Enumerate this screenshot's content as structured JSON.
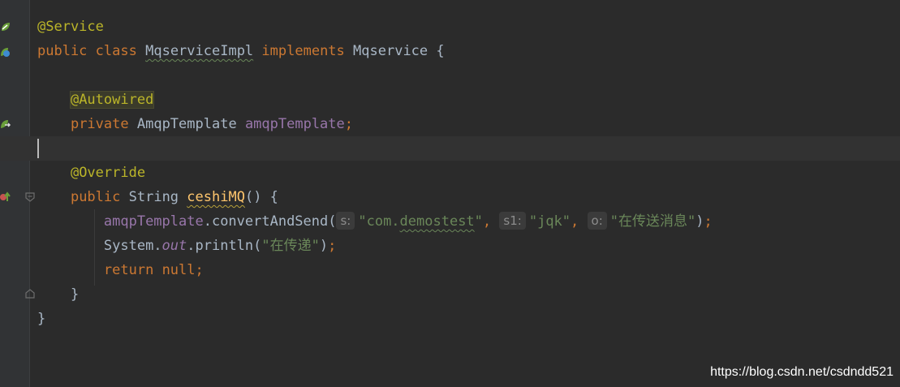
{
  "editor": {
    "language": "java",
    "colors": {
      "background": "#2b2b2b",
      "gutter": "#313335",
      "keyword": "#cc7832",
      "annotation": "#bbb529",
      "string": "#6a8759",
      "field": "#9876aa",
      "method_declaration": "#ffc66d",
      "default_text": "#a9b7c6",
      "inlay_hint": "#8c8c8c"
    },
    "gutter_icons": [
      "spring-bean-icon",
      "implementation-icon",
      "autowired-bean-icon",
      "override-method-icon",
      "fold-icon"
    ],
    "lines": {
      "l1": {
        "annotation": "@Service"
      },
      "l2": {
        "kw_public": "public",
        "kw_class": "class",
        "class_name": "MqserviceImpl",
        "kw_implements": "implements",
        "iface": "Mqservice",
        "brace": " {"
      },
      "l4": {
        "annotation": "@Autowired"
      },
      "l5": {
        "kw_private": "private",
        "type": "AmqpTemplate",
        "field": "amqpTemplate",
        "semi": ";"
      },
      "l7": {
        "annotation": "@Override"
      },
      "l8": {
        "kw_public": "public",
        "type": "String",
        "method": "ceshiMQ",
        "rest": "() {"
      },
      "l9": {
        "field": "amqpTemplate",
        "call": ".convertAndSend(",
        "hint_s": "s:",
        "arg1_quote_open": "\"com.",
        "arg1_word": "demostest",
        "arg1_quote_close": "\"",
        "comma1": ",",
        "hint_s1": "s1:",
        "arg2": "\"jqk\"",
        "comma2": ",",
        "hint_o": "o:",
        "arg3": "\"在传送消息\"",
        "close": ")",
        "semi": ";"
      },
      "l10": {
        "system": "System.",
        "out": "out",
        "println": ".println(",
        "arg": "\"在传递\"",
        "close": ")",
        "semi": ";"
      },
      "l11": {
        "kw_return": "return",
        "kw_null": "null",
        "semi": ";"
      },
      "l12": {
        "brace": "}"
      },
      "l13": {
        "brace": "}"
      }
    }
  },
  "watermark": "https://blog.csdn.net/csdndd521"
}
